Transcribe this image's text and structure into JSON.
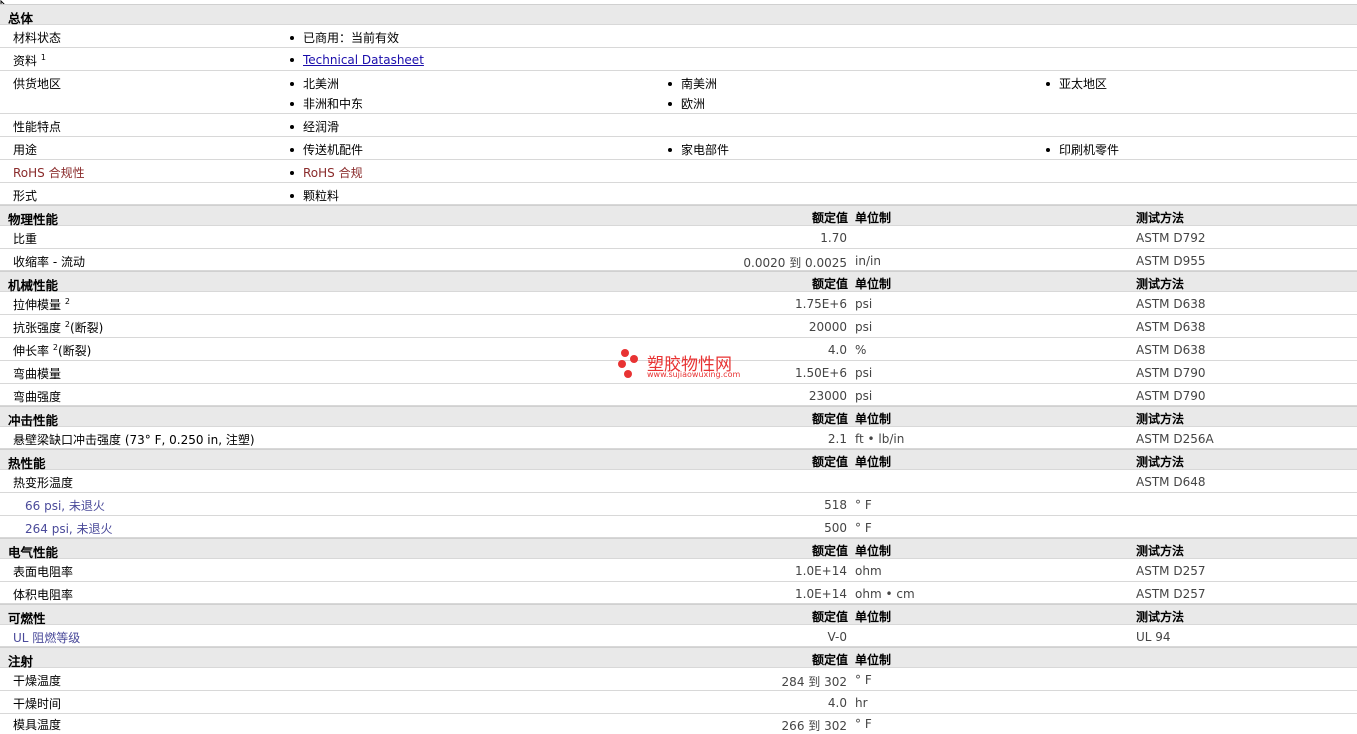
{
  "general": {
    "title": "总体",
    "status_label": "材料状态",
    "status_value": "已商用：当前有效",
    "doc_label": "资料",
    "doc_sup": "1",
    "doc_link": "Technical Datasheet",
    "region_label": "供货地区",
    "regions": [
      "北美洲",
      "南美洲",
      "亚太地区",
      "非洲和中东",
      "欧洲"
    ],
    "feature_label": "性能特点",
    "feature_value": "经润滑",
    "use_label": "用途",
    "uses": [
      "传送机配件",
      "家电部件",
      "印刷机零件"
    ],
    "rohs_label": "RoHS 合规性",
    "rohs_value": "RoHS 合规",
    "form_label": "形式",
    "form_value": "颗粒料"
  },
  "headers": {
    "value": "额定值",
    "unit": "单位制",
    "method": "测试方法"
  },
  "sections": {
    "physical": "物理性能",
    "mechanical": "机械性能",
    "impact": "冲击性能",
    "thermal": "热性能",
    "electrical": "电气性能",
    "flammability": "可燃性",
    "injection": "注射"
  },
  "physical": {
    "sg_label": "比重",
    "sg_value": "1.70",
    "sg_method": "ASTM D792",
    "shrink_label": "收缩率 - 流动",
    "shrink_value": "0.0020 到  0.0025",
    "shrink_unit": "in/in",
    "shrink_method": "ASTM D955"
  },
  "mechanical": {
    "tm_label": "拉伸模量",
    "tm_sup": "2",
    "tm_value": "1.75E+6",
    "tm_unit": "psi",
    "tm_method": "ASTM D638",
    "ts_label": "抗张强度",
    "ts_sup": "2",
    "ts_note": "(断裂)",
    "ts_value": "20000",
    "ts_unit": "psi",
    "ts_method": "ASTM D638",
    "el_label": "伸长率",
    "el_sup": "2",
    "el_note": "(断裂)",
    "el_value": "4.0",
    "el_unit": "%",
    "el_method": "ASTM D638",
    "fm_label": "弯曲模量",
    "fm_value": "1.50E+6",
    "fm_unit": "psi",
    "fm_method": "ASTM D790",
    "fs_label": "弯曲强度",
    "fs_value": "23000",
    "fs_unit": "psi",
    "fs_method": "ASTM D790"
  },
  "impact": {
    "izod_label": "悬壁梁缺口冲击强度",
    "izod_note": "(73°  F, 0.250 in, 注塑)",
    "izod_value": "2.1",
    "izod_unit": "ft • lb/in",
    "izod_method": "ASTM D256A"
  },
  "thermal": {
    "hdt_label": "热变形温度",
    "hdt_method": "ASTM D648",
    "hdt66_label": "66 psi, 未退火",
    "hdt66_value": "518",
    "hdt66_unit": "°  F",
    "hdt264_label": "264 psi, 未退火",
    "hdt264_value": "500",
    "hdt264_unit": "°  F"
  },
  "electrical": {
    "sr_label": "表面电阻率",
    "sr_value": "1.0E+14",
    "sr_unit": "ohm",
    "sr_method": "ASTM D257",
    "vr_label": "体积电阻率",
    "vr_value": "1.0E+14",
    "vr_unit": "ohm • cm",
    "vr_method": "ASTM D257"
  },
  "flammability": {
    "ul_label": "UL 阻燃等级",
    "ul_value": "V-0",
    "ul_method": "UL 94"
  },
  "injection": {
    "dt_label": "干燥温度",
    "dt_value": "284 到  302",
    "dt_unit": "°  F",
    "dtime_label": "干燥时间",
    "dtime_value": "4.0",
    "dtime_unit": "hr",
    "mt_label": "模具温度",
    "mt_value": "266 到  302",
    "mt_unit": "°  F"
  },
  "watermark": {
    "text": "塑胶物性网",
    "url": "www.sujiaowuxing.com",
    "color": "#e83333"
  }
}
